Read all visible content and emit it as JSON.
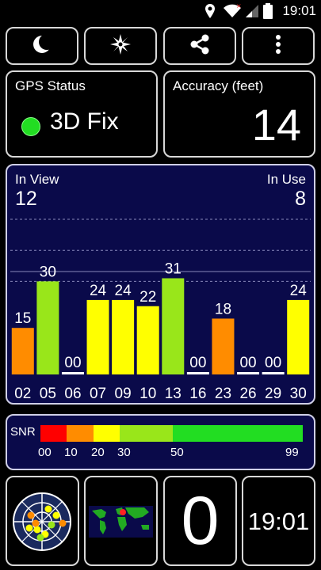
{
  "status_bar": {
    "time": "19:01"
  },
  "toolbar": {
    "buttons": [
      {
        "icon": "moon-icon"
      },
      {
        "icon": "compass-icon"
      },
      {
        "icon": "share-icon"
      },
      {
        "icon": "more-vert-icon"
      }
    ]
  },
  "gps_status": {
    "title": "GPS Status",
    "value": "3D Fix",
    "indicator_color": "#22dd22"
  },
  "accuracy": {
    "title": "Accuracy (feet)",
    "value": "14"
  },
  "satellites": {
    "in_view_label": "In View",
    "in_view": "12",
    "in_use_label": "In Use",
    "in_use": "8"
  },
  "chart_data": {
    "type": "bar",
    "categories": [
      "02",
      "05",
      "06",
      "07",
      "09",
      "10",
      "13",
      "16",
      "23",
      "26",
      "29",
      "30"
    ],
    "values": [
      15,
      30,
      0,
      24,
      24,
      22,
      31,
      0,
      18,
      0,
      0,
      24
    ],
    "value_labels": [
      "15",
      "30",
      "00",
      "24",
      "24",
      "22",
      "31",
      "00",
      "18",
      "00",
      "00",
      "24"
    ],
    "ylim": [
      0,
      50
    ],
    "grid": true
  },
  "snr": {
    "label": "SNR",
    "ticks": [
      "00",
      "10",
      "20",
      "30",
      "50",
      "99"
    ],
    "colors": [
      "#ff0000",
      "#ff8c00",
      "#ffff00",
      "#99e61a",
      "#22dd22"
    ]
  },
  "bottom": {
    "count": "0",
    "time": "19:01"
  }
}
